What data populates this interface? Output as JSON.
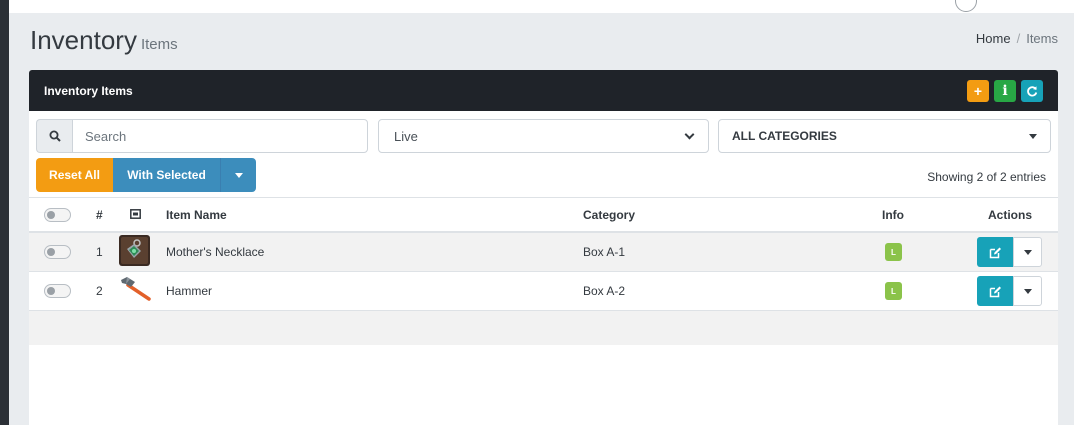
{
  "page": {
    "title": "Inventory",
    "subtitle": "Items",
    "breadcrumb": [
      "Home",
      "Items"
    ]
  },
  "card": {
    "title": "Inventory Items",
    "header_buttons": [
      {
        "icon": "plus-icon",
        "glyph": "+",
        "color": "#f39c12"
      },
      {
        "icon": "info-icon",
        "glyph": "i",
        "color": "#28a745"
      },
      {
        "icon": "refresh-icon",
        "glyph": "↻",
        "color": "#17a2b8"
      }
    ]
  },
  "filters": {
    "search_placeholder": "Search",
    "status_value": "Live",
    "category_value": "ALL CATEGORIES"
  },
  "actions": {
    "reset_label": "Reset All",
    "with_selected_label": "With Selected"
  },
  "showing_text": "Showing 2 of 2 entries",
  "table": {
    "columns": {
      "num": "#",
      "item_name": "Item Name",
      "category": "Category",
      "info": "Info",
      "actions": "Actions"
    },
    "rows": [
      {
        "num": "1",
        "name": "Mother's Necklace",
        "category": "Box A-1",
        "badge": "L",
        "thumb": "necklace"
      },
      {
        "num": "2",
        "name": "Hammer",
        "category": "Box A-2",
        "badge": "L",
        "thumb": "hammer"
      }
    ]
  },
  "colors": {
    "header_dark": "#1f2329",
    "orange": "#f39c12",
    "green": "#28a745",
    "teal": "#17a2b8",
    "blue": "#3c8dbc",
    "badge_green": "#8bc34a"
  }
}
